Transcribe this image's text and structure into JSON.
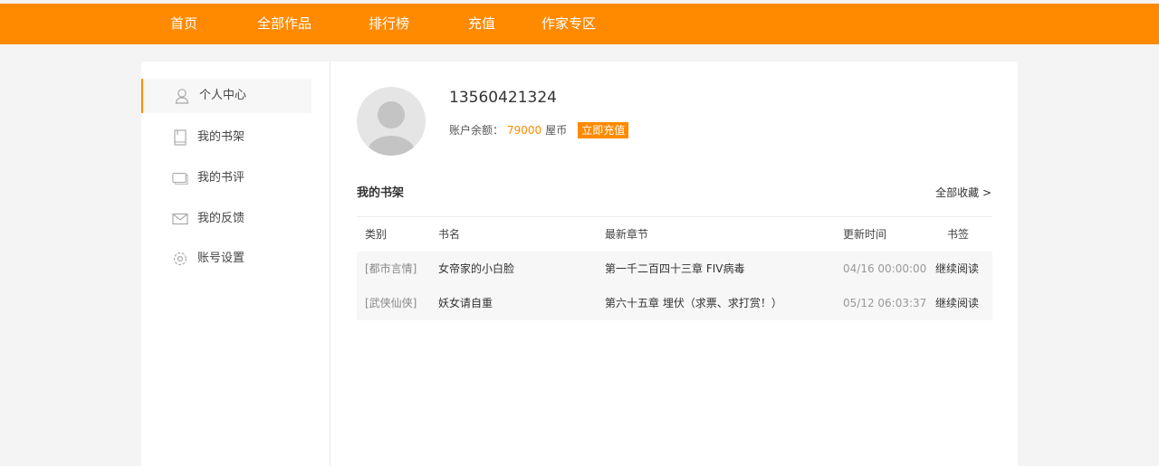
{
  "nav": {
    "items": [
      {
        "label": "首页"
      },
      {
        "label": "全部作品"
      },
      {
        "label": "排行榜"
      },
      {
        "label": "充值"
      },
      {
        "label": "作家专区"
      }
    ]
  },
  "sidebar": {
    "items": [
      {
        "label": "个人中心",
        "icon": "user-icon",
        "active": true
      },
      {
        "label": "我的书架",
        "icon": "book-icon",
        "active": false
      },
      {
        "label": "我的书评",
        "icon": "comment-icon",
        "active": false
      },
      {
        "label": "我的反馈",
        "icon": "mail-icon",
        "active": false
      },
      {
        "label": "账号设置",
        "icon": "gear-icon",
        "active": false
      }
    ]
  },
  "profile": {
    "username": "13560421324",
    "balance_label": "账户余额：",
    "balance_amount": "79000",
    "currency": "屋币",
    "recharge_label": "立即充值"
  },
  "shelf": {
    "title": "我的书架",
    "all_link": "全部收藏 >",
    "columns": [
      "类别",
      "书名",
      "最新章节",
      "更新时间",
      "书签"
    ],
    "rows": [
      {
        "type": "[都市言情]",
        "name": "女帝家的小白脸",
        "chapter": "第一千二百四十三章 FIV病毒",
        "time": "04/16 00:00:00",
        "bookmark": "继续阅读"
      },
      {
        "type": "[武侠仙侠]",
        "name": "妖女请自重",
        "chapter": "第六十五章 埋伏（求票、求打赏！）",
        "time": "05/12 06:03:37",
        "bookmark": "继续阅读"
      }
    ]
  },
  "colors": {
    "accent": "#ff8a00",
    "background": "#f4f4f4"
  }
}
